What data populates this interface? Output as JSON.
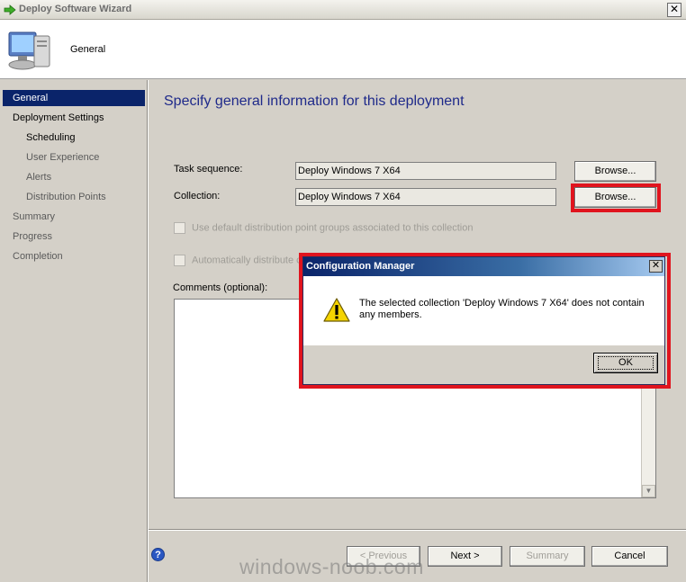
{
  "window": {
    "title": "Deploy Software Wizard",
    "close_glyph": "✕"
  },
  "header": {
    "title": "General",
    "icon": "computer-icon"
  },
  "nav": {
    "items": [
      {
        "label": "General",
        "selected": true
      },
      {
        "label": "Deployment Settings"
      },
      {
        "label": "Scheduling"
      },
      {
        "label": "User Experience"
      },
      {
        "label": "Alerts"
      },
      {
        "label": "Distribution Points"
      },
      {
        "label": "Summary"
      },
      {
        "label": "Progress"
      },
      {
        "label": "Completion"
      }
    ]
  },
  "main": {
    "heading": "Specify general information for this deployment",
    "task_sequence": {
      "label": "Task sequence:",
      "value": "Deploy Windows 7 X64",
      "browse": "Browse..."
    },
    "collection": {
      "label": "Collection:",
      "value": "Deploy Windows 7 X64",
      "browse": "Browse..."
    },
    "use_default_dp_groups": "Use default distribution point groups associated to this collection",
    "auto_distribute": "Automatically distribute co",
    "comments_label": "Comments (optional):"
  },
  "footer": {
    "previous": "< Previous",
    "next": "Next >",
    "summary": "Summary",
    "cancel": "Cancel",
    "watermark": "windows-noob.com"
  },
  "dialog": {
    "title": "Configuration Manager",
    "message": "The selected collection 'Deploy Windows 7 X64' does not contain any members.",
    "ok": "OK",
    "icon": "warning-icon"
  },
  "colors": {
    "highlight_red": "#e0141e",
    "nav_selected": "#0a246a",
    "heading_blue": "#1f2a8a"
  }
}
